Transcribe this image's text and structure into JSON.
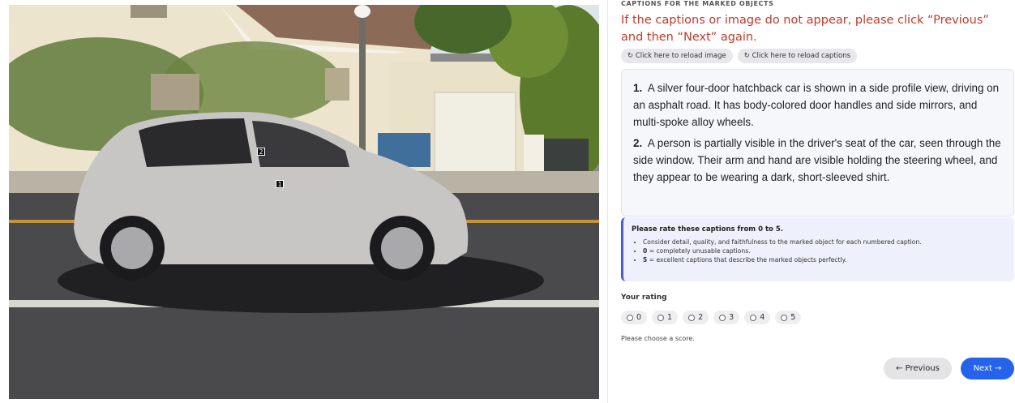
{
  "image_panel": {
    "markers": [
      {
        "id": "1"
      },
      {
        "id": "2"
      }
    ]
  },
  "header": {
    "section_label": "CAPTIONS FOR THE MARKED OBJECTS",
    "warning": "If the captions or image do not appear, please click “Previous” and then “Next” again."
  },
  "reload": {
    "image_label": "↻ Click here to reload image",
    "captions_label": "↻ Click here to reload captions"
  },
  "captions": [
    {
      "num": "1.",
      "text": "A silver four-door hatchback car is shown in a side profile view, driving on an asphalt road. It has body-colored door handles and side mirrors, and multi-spoke alloy wheels."
    },
    {
      "num": "2.",
      "text": "A person is partially visible in the driver's seat of the car, seen through the side window. Their arm and hand are visible holding the steering wheel, and they appear to be wearing a dark, short-sleeved shirt."
    }
  ],
  "instructions": {
    "title": "Please rate these captions from 0 to 5.",
    "items": [
      {
        "bold": "",
        "text": "Consider detail, quality, and faithfulness to the marked object for each numbered caption."
      },
      {
        "bold": "0",
        "text": " = completely unusable captions."
      },
      {
        "bold": "5",
        "text": " = excellent captions that describe the marked objects perfectly."
      }
    ]
  },
  "rating": {
    "label": "Your rating",
    "options": [
      "0",
      "1",
      "2",
      "3",
      "4",
      "5"
    ],
    "message": "Please choose a score."
  },
  "nav": {
    "previous_label": "← Previous",
    "next_label": "Next →"
  }
}
